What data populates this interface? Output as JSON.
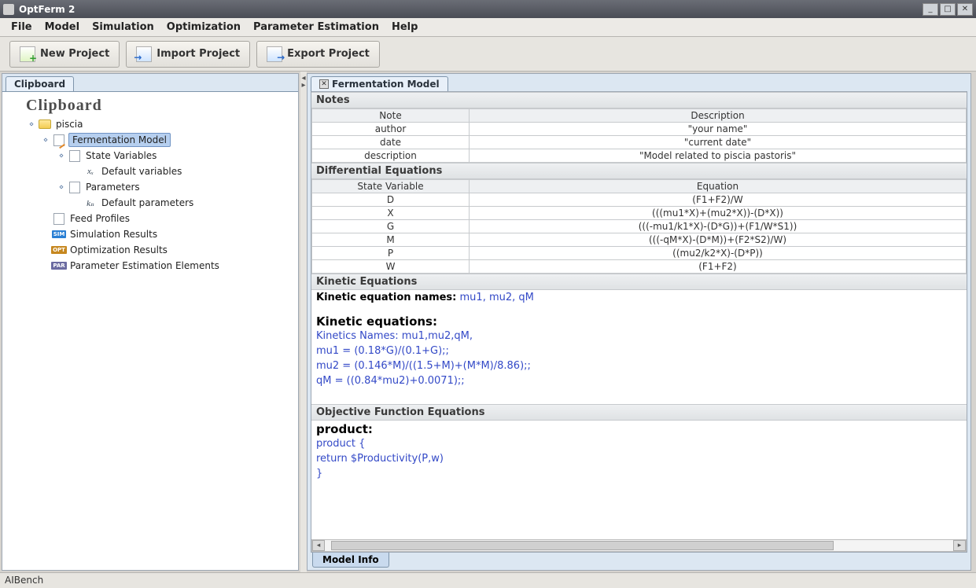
{
  "window": {
    "title": "OptFerm 2"
  },
  "menu": {
    "items": [
      "File",
      "Model",
      "Simulation",
      "Optimization",
      "Parameter Estimation",
      "Help"
    ]
  },
  "toolbar": {
    "new_label": "New Project",
    "import_label": "Import Project",
    "export_label": "Export Project"
  },
  "left": {
    "tab_label": "Clipboard",
    "heading": "Clipboard",
    "tree": {
      "project": "piscia",
      "model": "Fermentation Model",
      "state_vars": "State Variables",
      "default_vars": "Default variables",
      "params": "Parameters",
      "default_params": "Default parameters",
      "feed": "Feed Profiles",
      "sim": "Simulation Results",
      "opt": "Optimization Results",
      "parest": "Parameter Estimation Elements"
    }
  },
  "right": {
    "tab_label": "Fermentation Model",
    "notes": {
      "header": "Notes",
      "col_note": "Note",
      "col_desc": "Description",
      "rows": [
        {
          "note": "author",
          "desc": "\"your name\""
        },
        {
          "note": "date",
          "desc": "\"current date\""
        },
        {
          "note": "description",
          "desc": "\"Model related to piscia pastoris\""
        }
      ]
    },
    "diffeq": {
      "header": "Differential Equations",
      "col_var": "State Variable",
      "col_eq": "Equation",
      "rows": [
        {
          "v": "D",
          "eq": "(F1+F2)/W"
        },
        {
          "v": "X",
          "eq": "(((mu1*X)+(mu2*X))-(D*X))"
        },
        {
          "v": "G",
          "eq": "(((-mu1/k1*X)-(D*G))+(F1/W*S1))"
        },
        {
          "v": "M",
          "eq": "(((-qM*X)-(D*M))+(F2*S2)/W)"
        },
        {
          "v": "P",
          "eq": "((mu2/k2*X)-(D*P))"
        },
        {
          "v": "W",
          "eq": "(F1+F2)"
        }
      ]
    },
    "kinetic": {
      "header": "Kinetic Equations",
      "names_label": "Kinetic equation names:",
      "names_value": "mu1, mu2, qM",
      "eq_label": "Kinetic equations:",
      "lines": [
        "Kinetics Names: mu1,mu2,qM,",
        "mu1 = (0.18*G)/(0.1+G);;",
        "mu2 = (0.146*M)/((1.5+M)+(M*M)/8.86);;",
        "qM = ((0.84*mu2)+0.0071);;"
      ]
    },
    "objective": {
      "header": "Objective Function Equations",
      "label": "product:",
      "lines": [
        "product    {",
        "return $Productivity(P,w)",
        "}"
      ]
    },
    "bottom_tab": "Model Info"
  },
  "status": {
    "text": "AIBench"
  }
}
